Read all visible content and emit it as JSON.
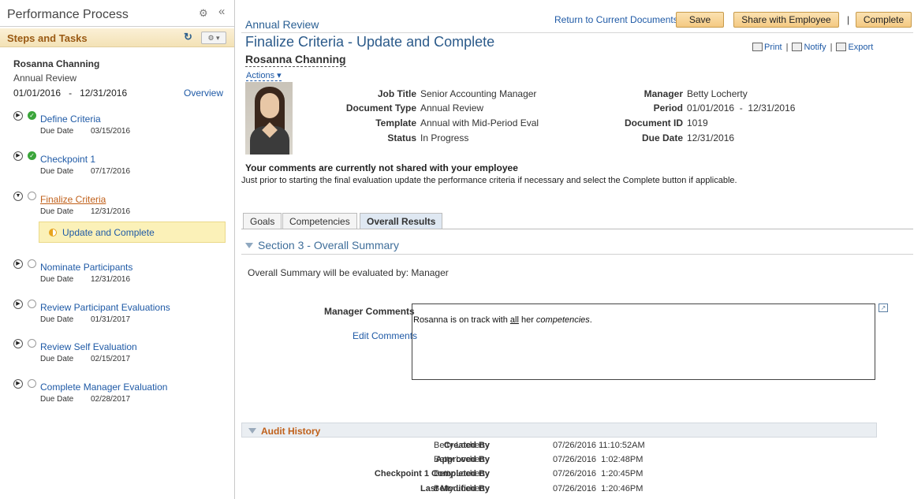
{
  "left_panel": {
    "title": "Performance Process",
    "steps_bar_title": "Steps and Tasks",
    "employee_name": "Rosanna Channing",
    "document_type": "Annual Review",
    "period_start": "01/01/2016",
    "period_sep": "-",
    "period_end": "12/31/2016",
    "overview_link": "Overview",
    "due_label": "Due Date",
    "steps": [
      {
        "name": "Define Criteria",
        "due": "03/15/2016",
        "status": "complete"
      },
      {
        "name": "Checkpoint 1",
        "due": "07/17/2016",
        "status": "complete"
      },
      {
        "name": "Finalize Criteria",
        "due": "12/31/2016",
        "status": "current"
      },
      {
        "name": "Nominate Participants",
        "due": "12/31/2016",
        "status": "open"
      },
      {
        "name": "Review Participant Evaluations",
        "due": "01/31/2017",
        "status": "open"
      },
      {
        "name": "Review Self Evaluation",
        "due": "02/15/2017",
        "status": "open"
      },
      {
        "name": "Complete Manager Evaluation",
        "due": "02/28/2017",
        "status": "open"
      }
    ],
    "current_task": "Update and Complete"
  },
  "header": {
    "breadcrumb": "Annual Review",
    "return_link": "Return to Current Documents",
    "save_label": "Save",
    "share_label": "Share with Employee",
    "separator": "|",
    "complete_label": "Complete"
  },
  "page": {
    "title": "Finalize Criteria - Update and Complete",
    "employee_name": "Rosanna Channing",
    "actions_label": "Actions",
    "print_label": "Print",
    "notify_label": "Notify",
    "export_label": "Export"
  },
  "details": {
    "job_title_label": "Job Title",
    "job_title": "Senior Accounting Manager",
    "document_type_label": "Document Type",
    "document_type": "Annual Review",
    "template_label": "Template",
    "template": "Annual with Mid-Period Eval",
    "status_label": "Status",
    "status": "In Progress",
    "manager_label": "Manager",
    "manager": "Betty Locherty",
    "period_label": "Period",
    "period": "01/01/2016  -  12/31/2016",
    "document_id_label": "Document ID",
    "document_id": "1019",
    "due_date_label": "Due Date",
    "due_date": "12/31/2016"
  },
  "notice": {
    "headline": "Your comments are currently not shared with your employee",
    "text": "Just prior to starting the final evaluation update the performance criteria if necessary and select the Complete button if applicable."
  },
  "tabs": [
    {
      "label": "Goals",
      "active": false
    },
    {
      "label": "Competencies",
      "active": false
    },
    {
      "label": "Overall Results",
      "active": true
    }
  ],
  "section": {
    "title": "Section 3 - Overall Summary",
    "evaluated_by": "Overall Summary will be evaluated by: Manager",
    "manager_comments_label": "Manager Comments",
    "edit_comments_link": "Edit Comments",
    "comment_part1": "Rosanna is on track with ",
    "comment_underlined": "all",
    "comment_part2": " her ",
    "comment_italic": "competencies",
    "comment_end": "."
  },
  "audit": {
    "title": "Audit History",
    "rows": [
      {
        "label": "Created By",
        "name": "Betty Locherty",
        "date": "07/26/2016 11:10:52AM"
      },
      {
        "label": "Approved By",
        "name": "Betty Locherty",
        "date": "07/26/2016  1:02:48PM"
      },
      {
        "label": "Checkpoint 1 Completed By",
        "name": "Betty Locherty",
        "date": "07/26/2016  1:20:45PM"
      },
      {
        "label": "Last Modified By",
        "name": "Betty Locherty",
        "date": "07/26/2016  1:20:46PM"
      }
    ]
  },
  "colors": {
    "link": "#1f5aa6",
    "accent_orange": "#c0601a",
    "button_gold": "#f4c982",
    "complete_green": "#3aa53a",
    "highlight_yellow": "#fbf1b8"
  }
}
